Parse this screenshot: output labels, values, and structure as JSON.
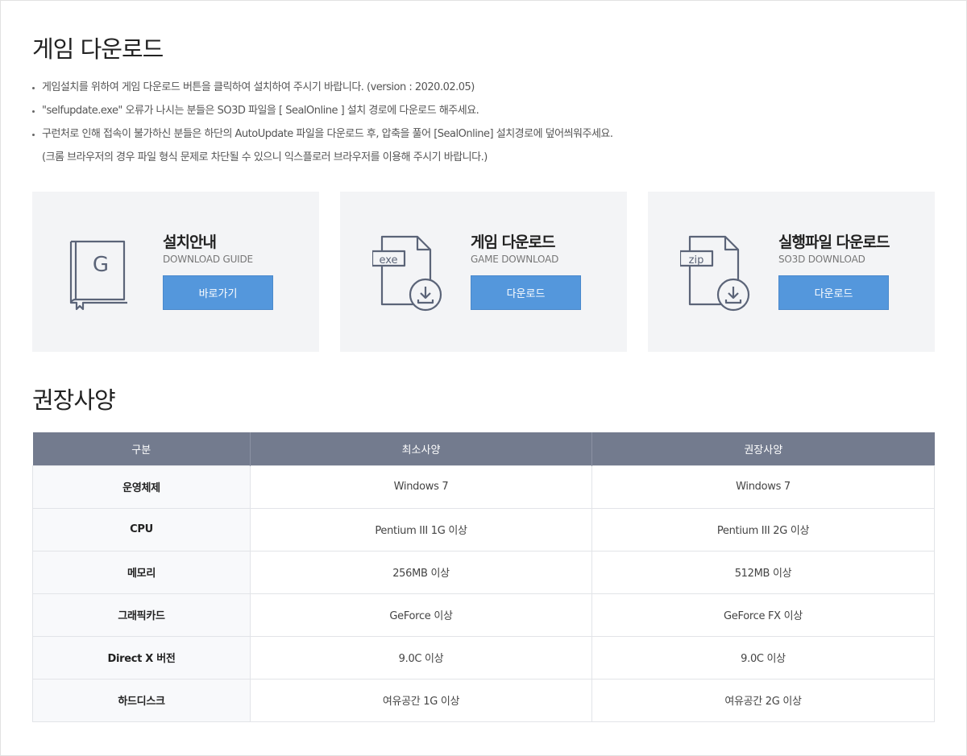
{
  "download_section": {
    "title": "게임 다운로드",
    "notes": [
      "게임설치를 위하여 게임 다운로드 버튼을 클릭하여 설치하여 주시기 바랍니다. (version : 2020.02.05)",
      "\"selfupdate.exe\" 오류가 나시는 분들은 SO3D 파일을 [ SealOnline ] 설치 경로에 다운로드 해주세요.",
      "구런처로 인해 접속이 불가하신 분들은 하단의 AutoUpdate 파일을 다운로드 후, 압축을 풀어 [SealOnline] 설치경로에 덮어씌워주세요.",
      "(크롬 브라우저의 경우 파일 형식 문제로 차단될 수 있으니 익스플로러 브라우저를 이용해 주시기 바랍니다.)"
    ],
    "cards": [
      {
        "title": "설치안내",
        "subtitle": "DOWNLOAD GUIDE",
        "button": "바로가기",
        "icon": "book-icon",
        "icon_letter": "G"
      },
      {
        "title": "게임 다운로드",
        "subtitle": "GAME DOWNLOAD",
        "button": "다운로드",
        "icon": "exe-file-download-icon",
        "icon_letter": "exe"
      },
      {
        "title": "실행파일 다운로드",
        "subtitle": "SO3D DOWNLOAD",
        "button": "다운로드",
        "icon": "zip-file-download-icon",
        "icon_letter": "zip"
      }
    ]
  },
  "spec_section": {
    "title": "권장사양",
    "headers": [
      "구분",
      "최소사양",
      "권장사양"
    ],
    "rows": [
      [
        "운영체제",
        "Windows 7",
        "Windows 7"
      ],
      [
        "CPU",
        "Pentium III 1G 이상",
        "Pentium III 2G 이상"
      ],
      [
        "메모리",
        "256MB 이상",
        "512MB 이상"
      ],
      [
        "그래픽카드",
        "GeForce 이상",
        "GeForce FX 이상"
      ],
      [
        "Direct X 버전",
        "9.0C 이상",
        "9.0C 이상"
      ],
      [
        "하드디스크",
        "여유공간 1G 이상",
        "여유공간 2G 이상"
      ]
    ]
  },
  "colors": {
    "accent_button": "#5497dc",
    "table_header": "#737b8e",
    "card_bg": "#f3f4f6",
    "icon_stroke": "#5b6478"
  }
}
